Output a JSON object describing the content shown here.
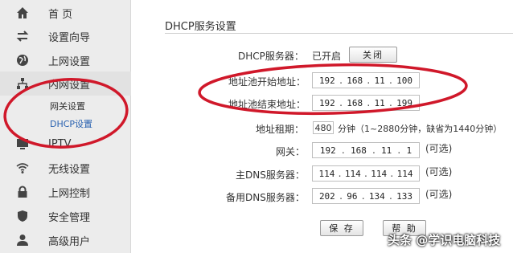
{
  "sidebar": {
    "items": [
      {
        "label": "首 页",
        "icon": "home-icon"
      },
      {
        "label": "设置向导",
        "icon": "arrows-icon"
      },
      {
        "label": "上网设置",
        "icon": "globe-icon"
      },
      {
        "label": "内网设置",
        "icon": "network-icon"
      },
      {
        "label": "IPTV",
        "icon": "tv-icon"
      },
      {
        "label": "无线设置",
        "icon": "wifi-icon"
      },
      {
        "label": "上网控制",
        "icon": "lock-icon"
      },
      {
        "label": "安全管理",
        "icon": "shield-icon"
      },
      {
        "label": "高级用户",
        "icon": "user-icon"
      }
    ],
    "subitems": [
      {
        "label": "网关设置"
      },
      {
        "label": "DHCP设置"
      }
    ]
  },
  "main": {
    "title": "DHCP服务设置",
    "dhcp_server": {
      "label": "DHCP服务器：",
      "status": "已开启",
      "toggle_button": "关闭"
    },
    "pool_start": {
      "label": "地址池开始地址：",
      "octets": [
        "192",
        "168",
        "11",
        "100"
      ]
    },
    "pool_end": {
      "label": "地址池结束地址：",
      "octets": [
        "192",
        "168",
        "11",
        "199"
      ]
    },
    "lease": {
      "label": "地址租期：",
      "value": "480",
      "hint": "分钟（1~2880分钟，缺省为1440分钟）"
    },
    "gateway": {
      "label": "网关：",
      "octets": [
        "192",
        "168",
        "11",
        "1"
      ],
      "optional": "(可选)"
    },
    "primary_dns": {
      "label": "主DNS服务器：",
      "octets": [
        "114",
        "114",
        "114",
        "114"
      ],
      "optional": "(可选)"
    },
    "secondary_dns": {
      "label": "备用DNS服务器：",
      "octets": [
        "202",
        "96",
        "134",
        "133"
      ],
      "optional": "(可选)"
    },
    "save_button": "保 存",
    "help_button": "帮 助"
  },
  "watermark": "头条 @学识电脑科技",
  "colors": {
    "annotation": "#d0182a",
    "sidebar_bg": "#ececec",
    "link": "#2a62b0"
  }
}
